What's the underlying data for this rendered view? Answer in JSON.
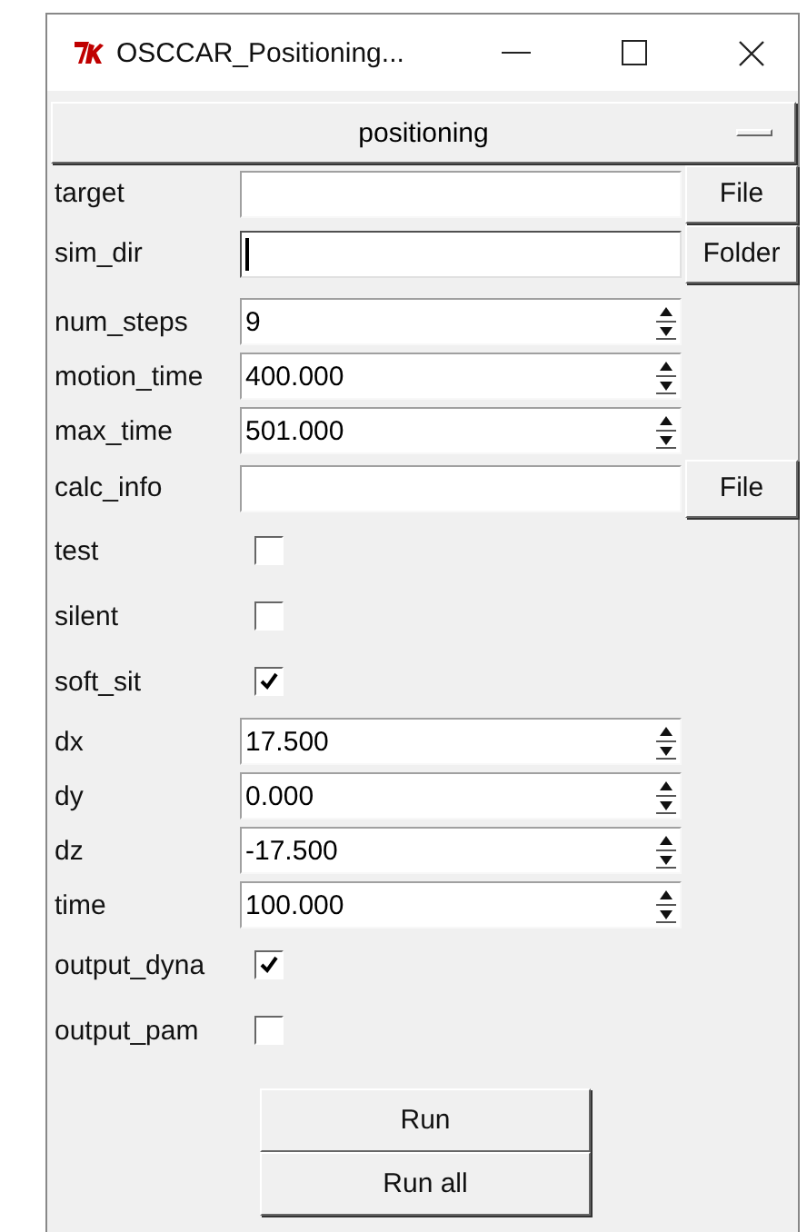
{
  "window": {
    "title": "OSCCAR_Positioning..."
  },
  "mode_menu": {
    "value": "positioning"
  },
  "fields": [
    {
      "kind": "file",
      "label": "target",
      "button": "File",
      "focused": false
    },
    {
      "kind": "file",
      "label": "sim_dir",
      "button": "Folder",
      "focused": true
    },
    {
      "kind": "spin",
      "label": "num_steps",
      "value": "9"
    },
    {
      "kind": "spin",
      "label": "motion_time",
      "value": "400.000"
    },
    {
      "kind": "spin",
      "label": "max_time",
      "value": "501.000"
    },
    {
      "kind": "file",
      "label": "calc_info",
      "button": "File",
      "focused": false
    },
    {
      "kind": "check",
      "label": "test",
      "checked": false
    },
    {
      "kind": "check",
      "label": "silent",
      "checked": false
    },
    {
      "kind": "check",
      "label": "soft_sit",
      "checked": true
    },
    {
      "kind": "spin",
      "label": "dx",
      "value": "17.500"
    },
    {
      "kind": "spin",
      "label": "dy",
      "value": "0.000"
    },
    {
      "kind": "spin",
      "label": "dz",
      "value": "-17.500"
    },
    {
      "kind": "spin",
      "label": "time",
      "value": "100.000"
    },
    {
      "kind": "check",
      "label": "output_dyna",
      "checked": true
    },
    {
      "kind": "check",
      "label": "output_pam",
      "checked": false
    }
  ],
  "buttons": [
    "Run",
    "Run all"
  ]
}
